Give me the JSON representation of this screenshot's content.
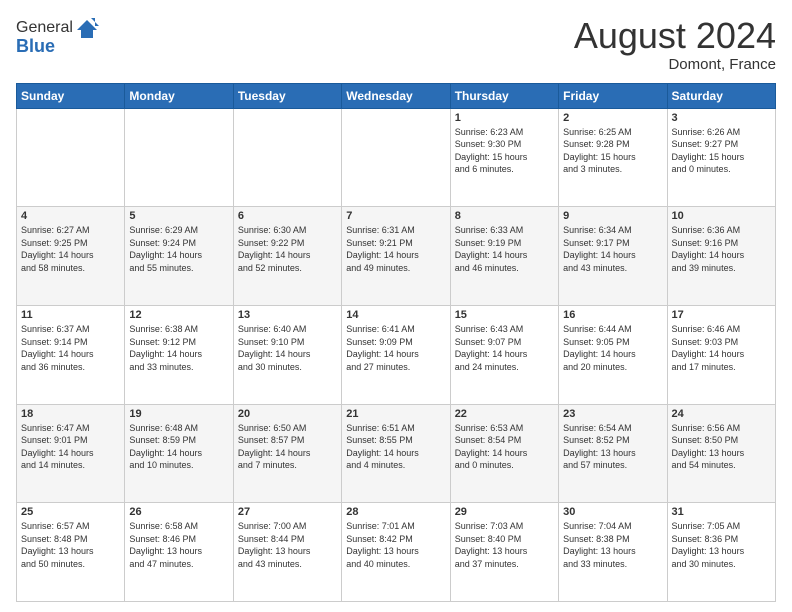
{
  "logo": {
    "line1": "General",
    "line2": "Blue"
  },
  "title": "August 2024",
  "location": "Domont, France",
  "days_header": [
    "Sunday",
    "Monday",
    "Tuesday",
    "Wednesday",
    "Thursday",
    "Friday",
    "Saturday"
  ],
  "weeks": [
    [
      {
        "num": "",
        "info": ""
      },
      {
        "num": "",
        "info": ""
      },
      {
        "num": "",
        "info": ""
      },
      {
        "num": "",
        "info": ""
      },
      {
        "num": "1",
        "info": "Sunrise: 6:23 AM\nSunset: 9:30 PM\nDaylight: 15 hours\nand 6 minutes."
      },
      {
        "num": "2",
        "info": "Sunrise: 6:25 AM\nSunset: 9:28 PM\nDaylight: 15 hours\nand 3 minutes."
      },
      {
        "num": "3",
        "info": "Sunrise: 6:26 AM\nSunset: 9:27 PM\nDaylight: 15 hours\nand 0 minutes."
      }
    ],
    [
      {
        "num": "4",
        "info": "Sunrise: 6:27 AM\nSunset: 9:25 PM\nDaylight: 14 hours\nand 58 minutes."
      },
      {
        "num": "5",
        "info": "Sunrise: 6:29 AM\nSunset: 9:24 PM\nDaylight: 14 hours\nand 55 minutes."
      },
      {
        "num": "6",
        "info": "Sunrise: 6:30 AM\nSunset: 9:22 PM\nDaylight: 14 hours\nand 52 minutes."
      },
      {
        "num": "7",
        "info": "Sunrise: 6:31 AM\nSunset: 9:21 PM\nDaylight: 14 hours\nand 49 minutes."
      },
      {
        "num": "8",
        "info": "Sunrise: 6:33 AM\nSunset: 9:19 PM\nDaylight: 14 hours\nand 46 minutes."
      },
      {
        "num": "9",
        "info": "Sunrise: 6:34 AM\nSunset: 9:17 PM\nDaylight: 14 hours\nand 43 minutes."
      },
      {
        "num": "10",
        "info": "Sunrise: 6:36 AM\nSunset: 9:16 PM\nDaylight: 14 hours\nand 39 minutes."
      }
    ],
    [
      {
        "num": "11",
        "info": "Sunrise: 6:37 AM\nSunset: 9:14 PM\nDaylight: 14 hours\nand 36 minutes."
      },
      {
        "num": "12",
        "info": "Sunrise: 6:38 AM\nSunset: 9:12 PM\nDaylight: 14 hours\nand 33 minutes."
      },
      {
        "num": "13",
        "info": "Sunrise: 6:40 AM\nSunset: 9:10 PM\nDaylight: 14 hours\nand 30 minutes."
      },
      {
        "num": "14",
        "info": "Sunrise: 6:41 AM\nSunset: 9:09 PM\nDaylight: 14 hours\nand 27 minutes."
      },
      {
        "num": "15",
        "info": "Sunrise: 6:43 AM\nSunset: 9:07 PM\nDaylight: 14 hours\nand 24 minutes."
      },
      {
        "num": "16",
        "info": "Sunrise: 6:44 AM\nSunset: 9:05 PM\nDaylight: 14 hours\nand 20 minutes."
      },
      {
        "num": "17",
        "info": "Sunrise: 6:46 AM\nSunset: 9:03 PM\nDaylight: 14 hours\nand 17 minutes."
      }
    ],
    [
      {
        "num": "18",
        "info": "Sunrise: 6:47 AM\nSunset: 9:01 PM\nDaylight: 14 hours\nand 14 minutes."
      },
      {
        "num": "19",
        "info": "Sunrise: 6:48 AM\nSunset: 8:59 PM\nDaylight: 14 hours\nand 10 minutes."
      },
      {
        "num": "20",
        "info": "Sunrise: 6:50 AM\nSunset: 8:57 PM\nDaylight: 14 hours\nand 7 minutes."
      },
      {
        "num": "21",
        "info": "Sunrise: 6:51 AM\nSunset: 8:55 PM\nDaylight: 14 hours\nand 4 minutes."
      },
      {
        "num": "22",
        "info": "Sunrise: 6:53 AM\nSunset: 8:54 PM\nDaylight: 14 hours\nand 0 minutes."
      },
      {
        "num": "23",
        "info": "Sunrise: 6:54 AM\nSunset: 8:52 PM\nDaylight: 13 hours\nand 57 minutes."
      },
      {
        "num": "24",
        "info": "Sunrise: 6:56 AM\nSunset: 8:50 PM\nDaylight: 13 hours\nand 54 minutes."
      }
    ],
    [
      {
        "num": "25",
        "info": "Sunrise: 6:57 AM\nSunset: 8:48 PM\nDaylight: 13 hours\nand 50 minutes."
      },
      {
        "num": "26",
        "info": "Sunrise: 6:58 AM\nSunset: 8:46 PM\nDaylight: 13 hours\nand 47 minutes."
      },
      {
        "num": "27",
        "info": "Sunrise: 7:00 AM\nSunset: 8:44 PM\nDaylight: 13 hours\nand 43 minutes."
      },
      {
        "num": "28",
        "info": "Sunrise: 7:01 AM\nSunset: 8:42 PM\nDaylight: 13 hours\nand 40 minutes."
      },
      {
        "num": "29",
        "info": "Sunrise: 7:03 AM\nSunset: 8:40 PM\nDaylight: 13 hours\nand 37 minutes."
      },
      {
        "num": "30",
        "info": "Sunrise: 7:04 AM\nSunset: 8:38 PM\nDaylight: 13 hours\nand 33 minutes."
      },
      {
        "num": "31",
        "info": "Sunrise: 7:05 AM\nSunset: 8:36 PM\nDaylight: 13 hours\nand 30 minutes."
      }
    ]
  ]
}
